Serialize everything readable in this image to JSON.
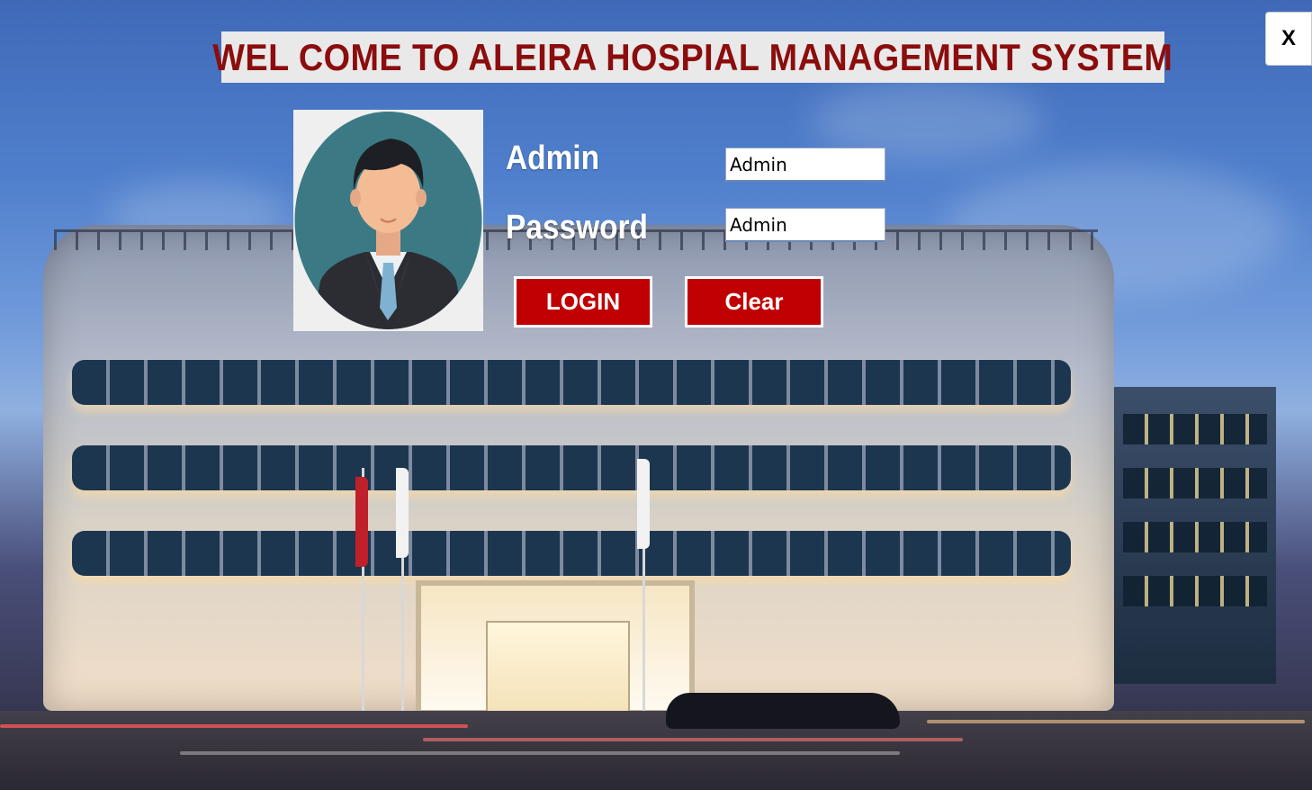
{
  "window": {
    "title": "WEL COME TO ALEIRA HOSPIAL MANAGEMENT SYSTEM",
    "close_label": "X"
  },
  "background": {
    "description_icon": "hospital-building-photo"
  },
  "login_form": {
    "avatar_icon": "businessman-avatar-icon",
    "admin_label": "Admin",
    "password_label": "Password",
    "admin_value": "Admin",
    "password_value": "Admin",
    "login_button": "LOGIN",
    "clear_button": "Clear"
  },
  "colors": {
    "title_text": "#8b0d0d",
    "button_bg": "#c00000",
    "label_text": "#ffffff"
  }
}
